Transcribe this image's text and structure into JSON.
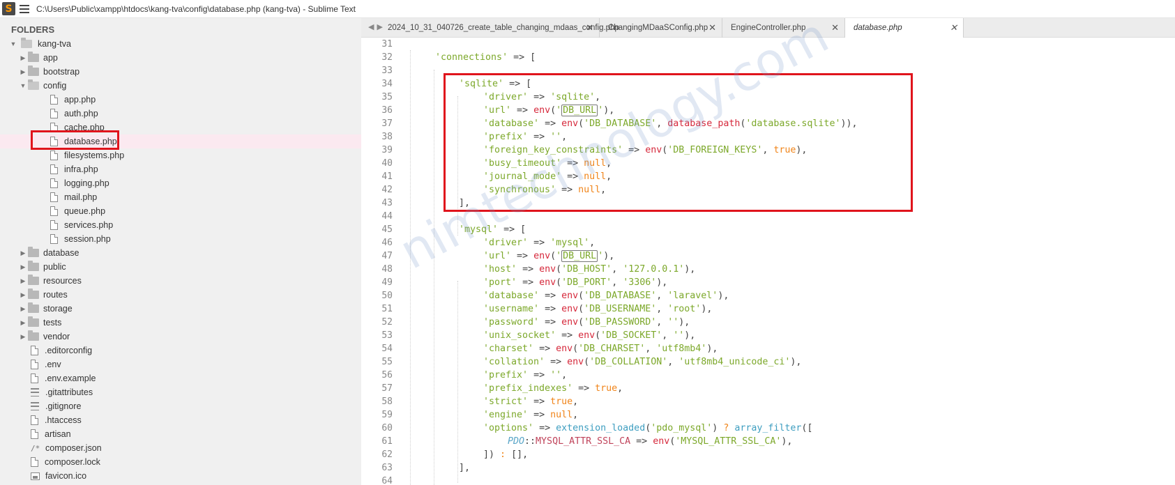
{
  "window": {
    "title": "C:\\Users\\Public\\xampp\\htdocs\\kang-tva\\config\\database.php (kang-tva) - Sublime Text",
    "logo_letter": "S"
  },
  "sidebar": {
    "heading": "FOLDERS",
    "root": "kang-tva",
    "items": [
      {
        "label": "app",
        "type": "folder"
      },
      {
        "label": "bootstrap",
        "type": "folder"
      },
      {
        "label": "config",
        "type": "folder-open"
      },
      {
        "label": "app.php",
        "type": "file"
      },
      {
        "label": "auth.php",
        "type": "file"
      },
      {
        "label": "cache.php",
        "type": "file"
      },
      {
        "label": "database.php",
        "type": "file"
      },
      {
        "label": "filesystems.php",
        "type": "file"
      },
      {
        "label": "infra.php",
        "type": "file"
      },
      {
        "label": "logging.php",
        "type": "file"
      },
      {
        "label": "mail.php",
        "type": "file"
      },
      {
        "label": "queue.php",
        "type": "file"
      },
      {
        "label": "services.php",
        "type": "file"
      },
      {
        "label": "session.php",
        "type": "file"
      },
      {
        "label": "database",
        "type": "folder"
      },
      {
        "label": "public",
        "type": "folder"
      },
      {
        "label": "resources",
        "type": "folder"
      },
      {
        "label": "routes",
        "type": "folder"
      },
      {
        "label": "storage",
        "type": "folder"
      },
      {
        "label": "tests",
        "type": "folder"
      },
      {
        "label": "vendor",
        "type": "folder"
      },
      {
        "label": ".editorconfig",
        "type": "file"
      },
      {
        "label": ".env",
        "type": "file"
      },
      {
        "label": ".env.example",
        "type": "file"
      },
      {
        "label": ".gitattributes",
        "type": "lines"
      },
      {
        "label": ".gitignore",
        "type": "lines"
      },
      {
        "label": ".htaccess",
        "type": "file"
      },
      {
        "label": "artisan",
        "type": "file"
      },
      {
        "label": "composer.json",
        "type": "comment"
      },
      {
        "label": "composer.lock",
        "type": "file"
      },
      {
        "label": "favicon.ico",
        "type": "image"
      }
    ]
  },
  "tabs": [
    {
      "label": "2024_10_31_040726_create_table_changing_mdaas_config.php"
    },
    {
      "label": "ChangingMDaaSConfig.php"
    },
    {
      "label": "EngineController.php"
    },
    {
      "label": "database.php"
    }
  ],
  "editor": {
    "line_numbers": [
      "31",
      "32",
      "33",
      "34",
      "35",
      "36",
      "37",
      "38",
      "39",
      "40",
      "41",
      "42",
      "43",
      "44",
      "45",
      "46",
      "47",
      "48",
      "49",
      "50",
      "51",
      "52",
      "53",
      "54",
      "55",
      "56",
      "57",
      "58",
      "59",
      "60",
      "61",
      "62",
      "63",
      "64"
    ],
    "code": {
      "connections": "'connections'",
      "sqlite": "'sqlite'",
      "driver_k": "'driver'",
      "driver_sqlite": "'sqlite'",
      "url_k": "'url'",
      "env": "env",
      "db_url": "DB_URL",
      "database_k": "'database'",
      "db_database": "'DB_DATABASE'",
      "database_path": "database_path",
      "sqlite_file": "'database.sqlite'",
      "prefix_k": "'prefix'",
      "empty": "''",
      "fk_k": "'foreign_key_constraints'",
      "db_fk": "'DB_FOREIGN_KEYS'",
      "true": "true",
      "busy_k": "'busy_timeout'",
      "null": "null",
      "journal_k": "'journal_mode'",
      "sync_k": "'synchronous'",
      "mysql": "'mysql'",
      "driver_mysql": "'mysql'",
      "host_k": "'host'",
      "db_host": "'DB_HOST'",
      "host_v": "'127.0.0.1'",
      "port_k": "'port'",
      "db_port": "'DB_PORT'",
      "port_v": "'3306'",
      "laravel": "'laravel'",
      "username_k": "'username'",
      "db_username": "'DB_USERNAME'",
      "root": "'root'",
      "password_k": "'password'",
      "db_password": "'DB_PASSWORD'",
      "socket_k": "'unix_socket'",
      "db_socket": "'DB_SOCKET'",
      "charset_k": "'charset'",
      "db_charset": "'DB_CHARSET'",
      "charset_v": "'utf8mb4'",
      "collation_k": "'collation'",
      "db_collation": "'DB_COLLATION'",
      "collation_v": "'utf8mb4_unicode_ci'",
      "prefix_idx_k": "'prefix_indexes'",
      "strict_k": "'strict'",
      "engine_k": "'engine'",
      "options_k": "'options'",
      "ext_loaded": "extension_loaded",
      "pdo_mysql": "'pdo_mysql'",
      "array_filter": "array_filter",
      "pdo": "PDO",
      "ssl_const": "MYSQL_ATTR_SSL_CA",
      "mysql_ssl": "'MYSQL_ATTR_SSL_CA'"
    }
  },
  "watermark": "nimtechnology.com",
  "colors": {
    "highlight": "#e0141c",
    "string": "#7ca82a",
    "function": "#d6283b",
    "keyword": "#f08419"
  }
}
